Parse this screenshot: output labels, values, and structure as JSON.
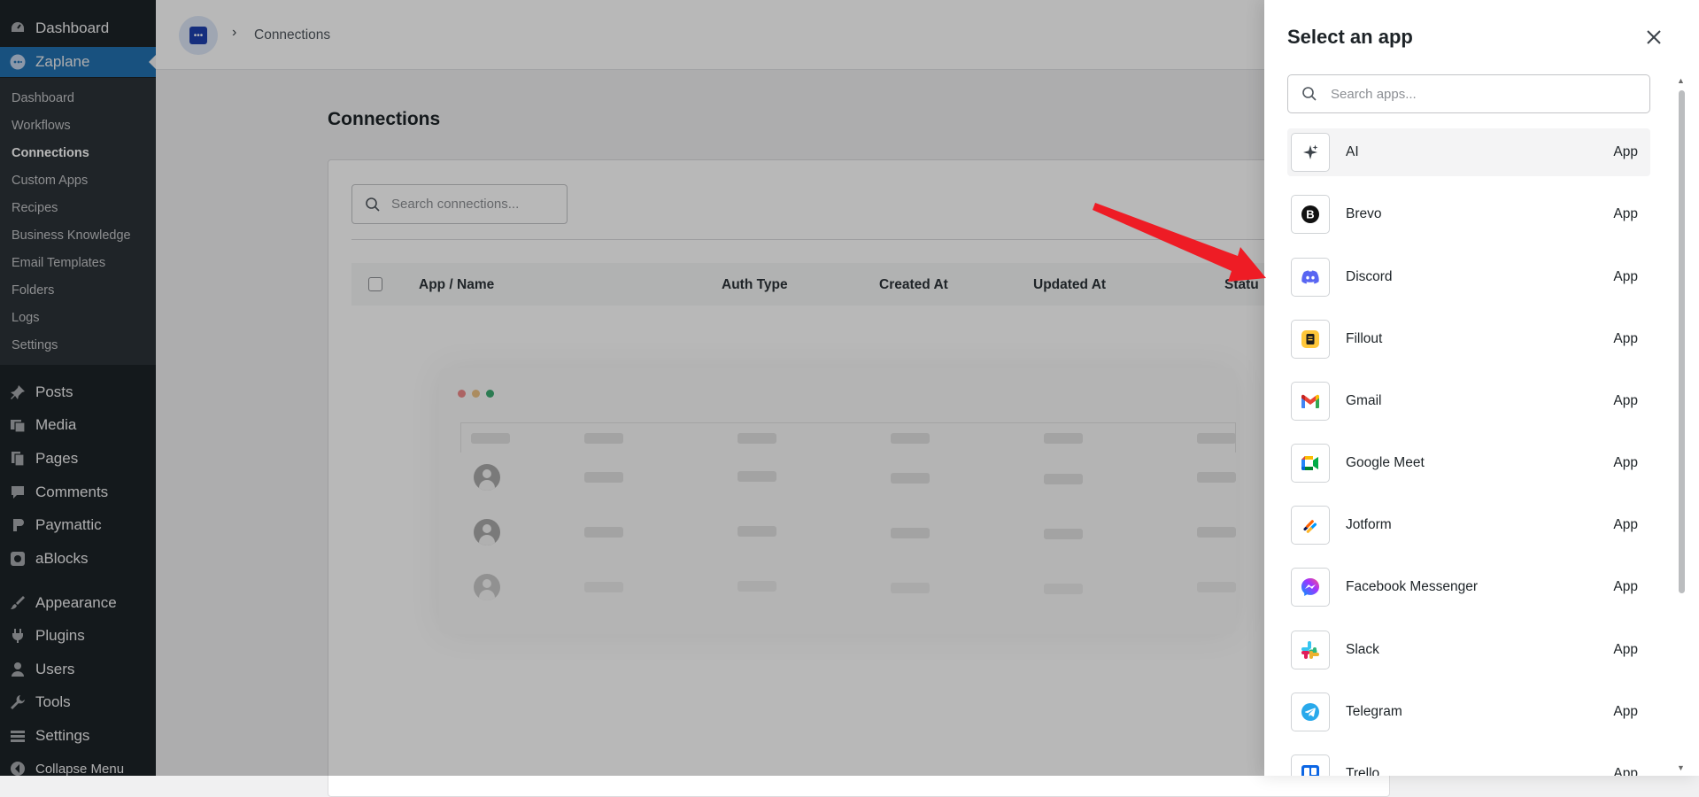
{
  "admin_menu": {
    "top_items": [
      {
        "label": "Dashboard",
        "icon": "dashboard-icon"
      },
      {
        "label": "Zaplane",
        "icon": "zaplane-icon"
      }
    ],
    "zaplane_submenu": [
      {
        "label": "Dashboard"
      },
      {
        "label": "Workflows"
      },
      {
        "label": "Connections"
      },
      {
        "label": "Custom Apps"
      },
      {
        "label": "Recipes"
      },
      {
        "label": "Business Knowledge"
      },
      {
        "label": "Email Templates"
      },
      {
        "label": "Folders"
      },
      {
        "label": "Logs"
      },
      {
        "label": "Settings"
      }
    ],
    "main_items": [
      {
        "label": "Posts",
        "icon": "pin-icon"
      },
      {
        "label": "Media",
        "icon": "media-icon"
      },
      {
        "label": "Pages",
        "icon": "page-icon"
      },
      {
        "label": "Comments",
        "icon": "comment-icon"
      },
      {
        "label": "Paymattic",
        "icon": "paymattic-icon"
      },
      {
        "label": "aBlocks",
        "icon": "ablocks-icon"
      },
      {
        "label": "Appearance",
        "icon": "brush-icon"
      },
      {
        "label": "Plugins",
        "icon": "plug-icon"
      },
      {
        "label": "Users",
        "icon": "user-icon"
      },
      {
        "label": "Tools",
        "icon": "wrench-icon"
      },
      {
        "label": "Settings",
        "icon": "settings-icon"
      },
      {
        "label": "Collapse Menu",
        "icon": "collapse-icon"
      }
    ]
  },
  "breadcrumb": {
    "current": "Connections"
  },
  "page": {
    "title": "Connections",
    "search_placeholder": "Search connections...",
    "columns": [
      "App / Name",
      "Auth Type",
      "Created At",
      "Updated At",
      "Statu"
    ]
  },
  "drawer": {
    "title": "Select an app",
    "search_placeholder": "Search apps...",
    "apps": [
      {
        "name": "AI",
        "type": "App",
        "icon": "sparkle-icon"
      },
      {
        "name": "Brevo",
        "type": "App",
        "icon": "brevo-icon"
      },
      {
        "name": "Discord",
        "type": "App",
        "icon": "discord-icon"
      },
      {
        "name": "Fillout",
        "type": "App",
        "icon": "fillout-icon"
      },
      {
        "name": "Gmail",
        "type": "App",
        "icon": "gmail-icon"
      },
      {
        "name": "Google Meet",
        "type": "App",
        "icon": "google-meet-icon"
      },
      {
        "name": "Jotform",
        "type": "App",
        "icon": "jotform-icon"
      },
      {
        "name": "Facebook Messenger",
        "type": "App",
        "icon": "messenger-icon"
      },
      {
        "name": "Slack",
        "type": "App",
        "icon": "slack-icon"
      },
      {
        "name": "Telegram",
        "type": "App",
        "icon": "telegram-icon"
      },
      {
        "name": "Trello",
        "type": "App",
        "icon": "trello-icon"
      }
    ]
  },
  "colors": {
    "wp_sidebar": "#1d2327",
    "wp_accent": "#2271b1",
    "annotation_arrow": "#ee1c25",
    "discord": "#5865f2"
  }
}
